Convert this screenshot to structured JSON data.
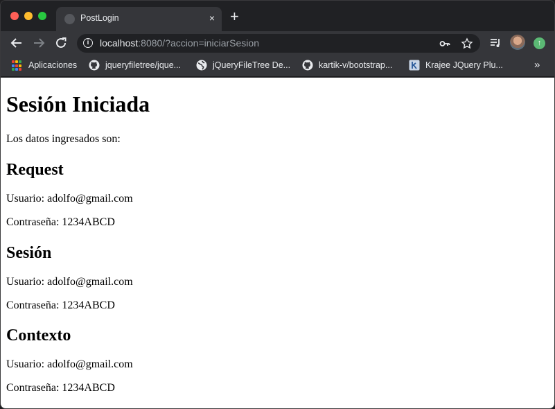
{
  "browser": {
    "tab": {
      "title": "PostLogin",
      "close_label": "×"
    },
    "new_tab_label": "+",
    "address": {
      "host": "localhost",
      "rest": ":8080/?accion=iniciarSesion"
    },
    "bookmarks": [
      {
        "label": "Aplicaciones",
        "icon": "apps-grid-icon"
      },
      {
        "label": "jqueryfiletree/jque...",
        "icon": "github-icon"
      },
      {
        "label": "jQueryFileTree De...",
        "icon": "globe-icon"
      },
      {
        "label": "kartik-v/bootstrap...",
        "icon": "github-icon"
      },
      {
        "label": "Krajee JQuery Plu...",
        "icon": "krajee-icon"
      }
    ],
    "more_bookmarks_label": "»",
    "colors": {
      "chrome_dark": "#202124",
      "toolbar": "#35363a",
      "accent_green": "#5bb974"
    }
  },
  "page": {
    "title": "Sesión Iniciada",
    "intro": "Los datos ingresados son:",
    "sections": [
      {
        "heading": "Request",
        "user": "Usuario: adolfo@gmail.com",
        "password": "Contraseña: 1234ABCD"
      },
      {
        "heading": "Sesión",
        "user": "Usuario: adolfo@gmail.com",
        "password": "Contraseña: 1234ABCD"
      },
      {
        "heading": "Contexto",
        "user": "Usuario: adolfo@gmail.com",
        "password": "Contraseña: 1234ABCD"
      }
    ]
  }
}
